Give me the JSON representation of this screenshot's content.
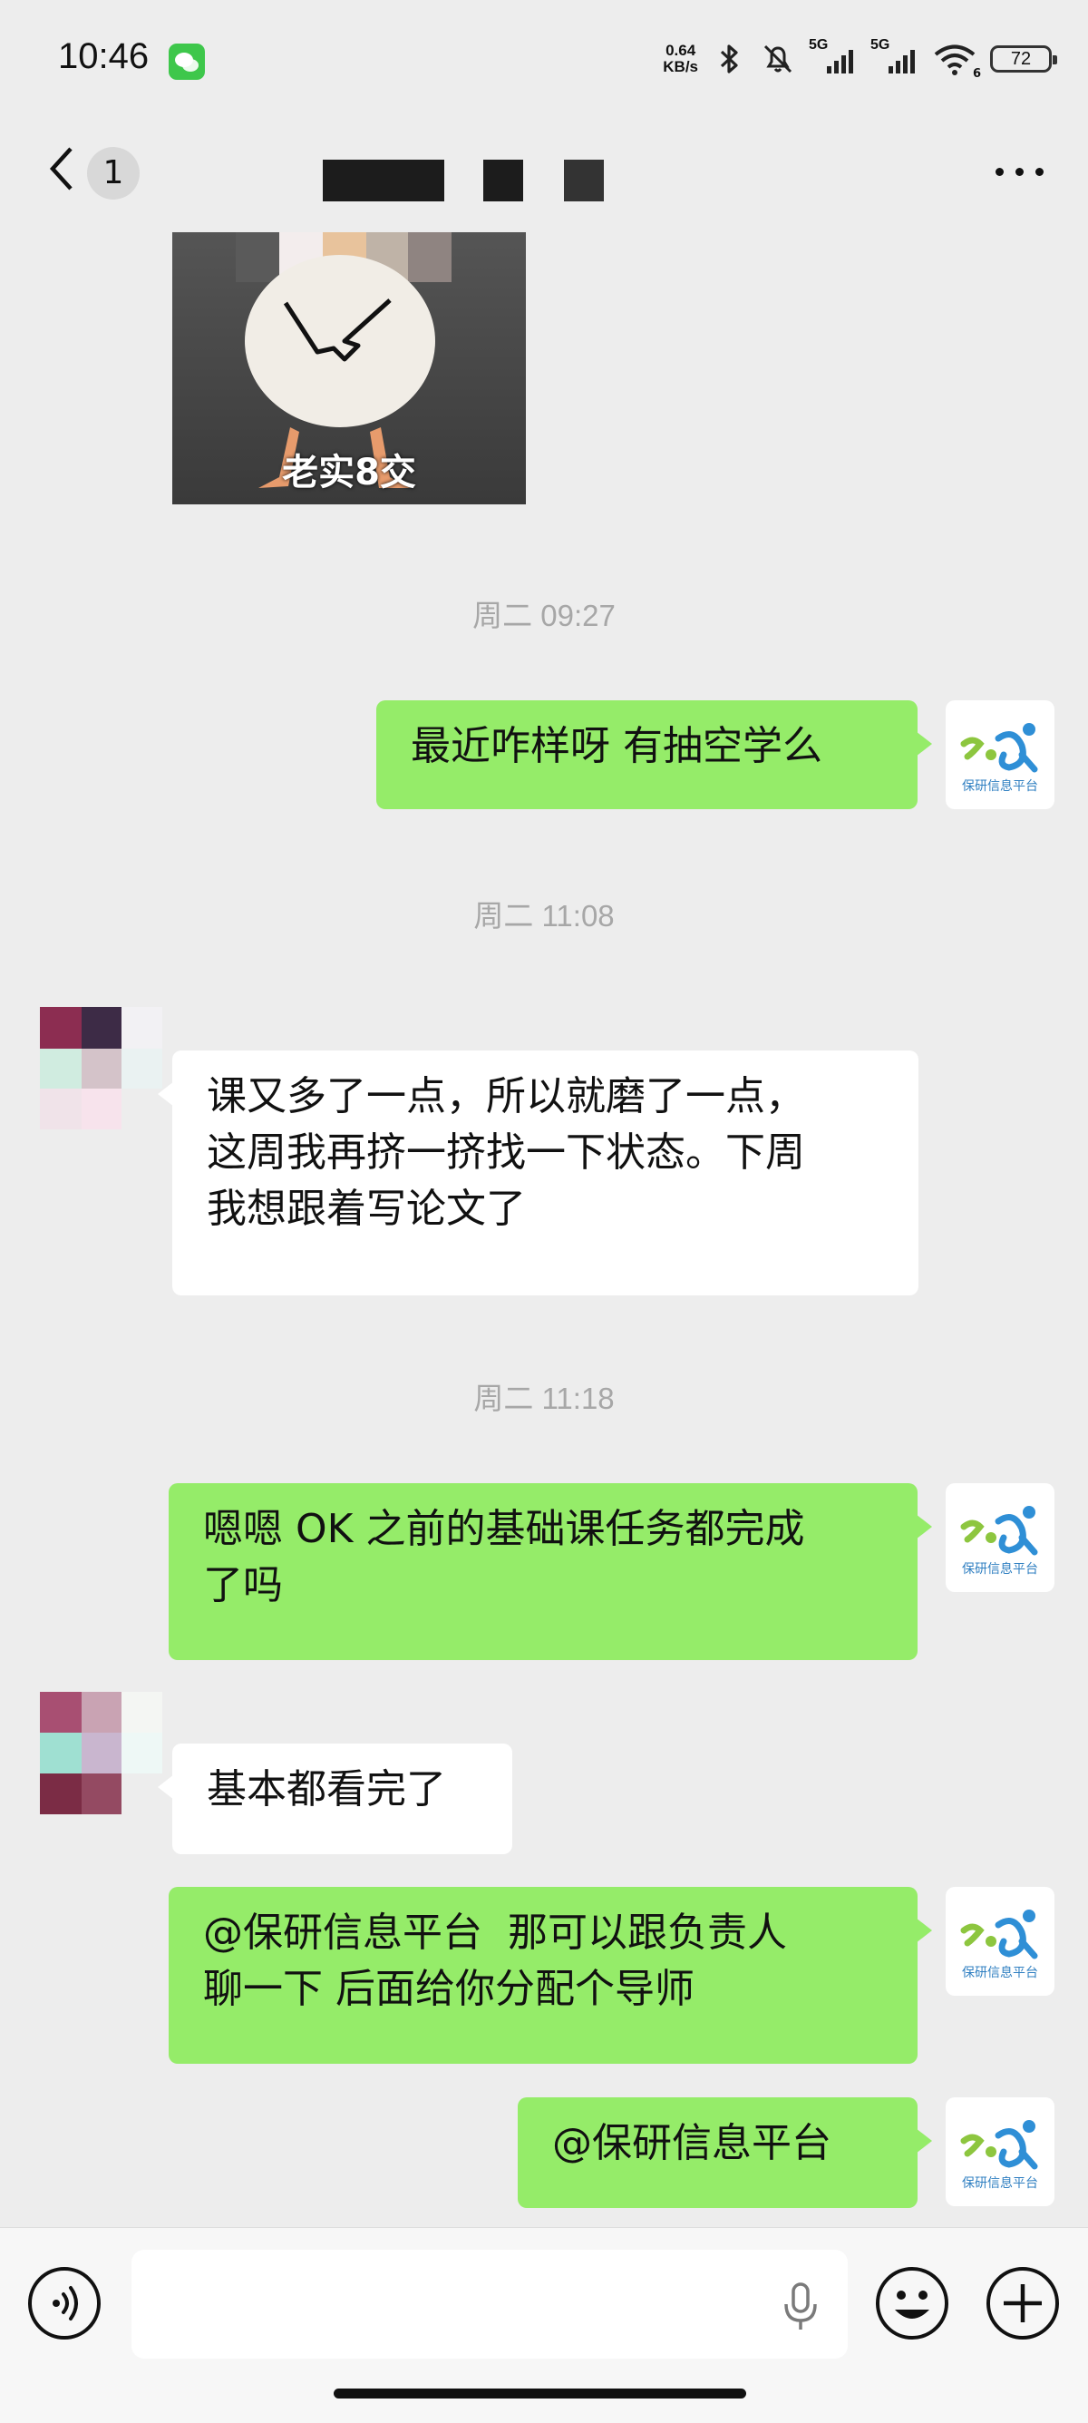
{
  "status_bar": {
    "time": "10:46",
    "net_speed_value": "0.64",
    "net_speed_unit": "KB/s",
    "signal1_label": "5G",
    "signal2_label": "5G",
    "wifi_sub": "6",
    "battery": "72"
  },
  "nav": {
    "unread_count": "1"
  },
  "messages": {
    "sticker_caption": "老实8交",
    "ts1": "周二 09:27",
    "m1": "最近咋样呀 有抽空学么",
    "ts2": "周二 11:08",
    "m2": "课又多了一点，所以就磨了一点，\n这周我再挤一挤找一下状态。下周\n我想跟着写论文了",
    "ts3": "周二 11:18",
    "m3": "嗯嗯 OK 之前的基础课任务都完成\n了吗",
    "m4": "基本都看完了",
    "m5": "@保研信息平台  那可以跟负责人\n聊一下 后面给你分配个导师",
    "m6": "@保研信息平台"
  },
  "self_avatar_logo_text": "保研信息平台",
  "colors": {
    "outgoing_bubble": "#95ec69",
    "incoming_bubble": "#ffffff",
    "chat_background": "#ededed"
  },
  "input_bar": {
    "input_value": "",
    "icons": [
      "voice-icon",
      "mic-icon",
      "emoji-icon",
      "plus-icon"
    ]
  }
}
